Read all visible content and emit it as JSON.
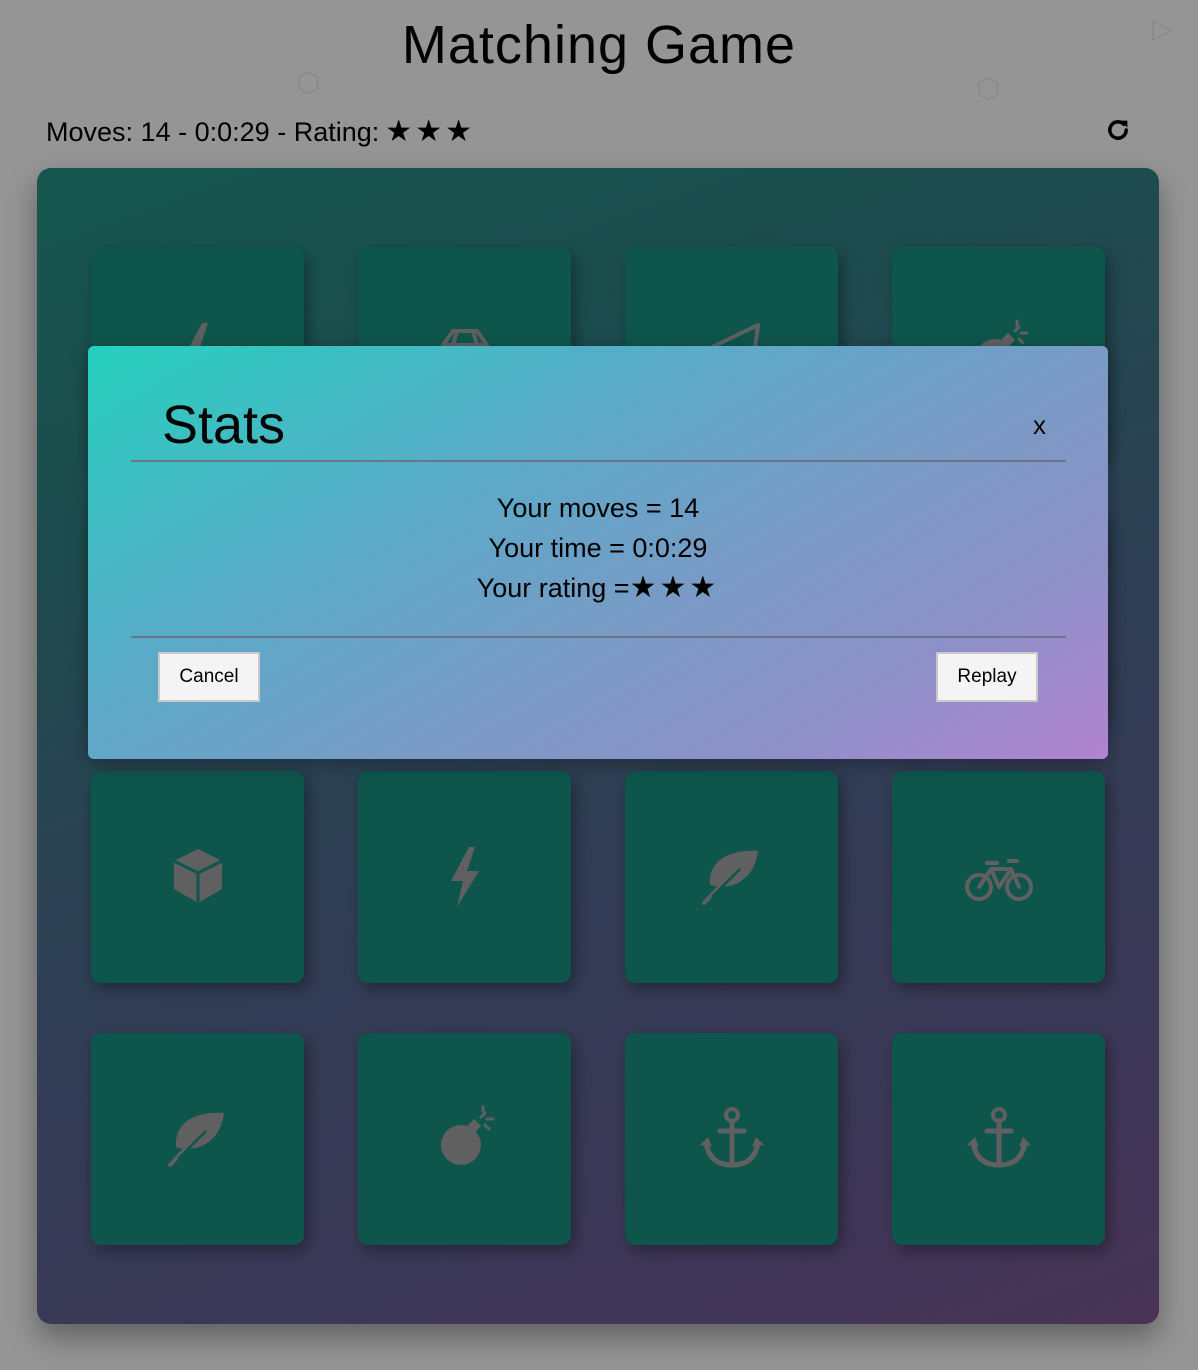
{
  "title": "Matching Game",
  "score_panel": {
    "moves_label": "Moves:",
    "moves": "14",
    "sep1": "-",
    "time": "0:0:29",
    "sep2": "-",
    "rating_label": "Rating:",
    "stars": [
      "★",
      "★",
      "★"
    ],
    "restart_icon": "restart-icon"
  },
  "cards": [
    {
      "icon": "bolt"
    },
    {
      "icon": "diamond"
    },
    {
      "icon": "paper-plane"
    },
    {
      "icon": "bomb"
    },
    {
      "icon": "hidden"
    },
    {
      "icon": "hidden"
    },
    {
      "icon": "hidden"
    },
    {
      "icon": "hidden"
    },
    {
      "icon": "cube"
    },
    {
      "icon": "bolt"
    },
    {
      "icon": "leaf"
    },
    {
      "icon": "bicycle"
    },
    {
      "icon": "leaf"
    },
    {
      "icon": "bomb"
    },
    {
      "icon": "anchor"
    },
    {
      "icon": "anchor"
    }
  ],
  "modal": {
    "title": "Stats",
    "close": "x",
    "moves_text": "Your moves = 14",
    "time_text": "Your time = 0:0:29",
    "rating_text": "Your rating =",
    "stars": [
      "★",
      "★",
      "★"
    ],
    "cancel_label": "Cancel",
    "replay_label": "Replay"
  },
  "colors": {
    "card": "#157a6d",
    "icon": "#8a8a8a",
    "page_bg": "#d6d6d6"
  }
}
